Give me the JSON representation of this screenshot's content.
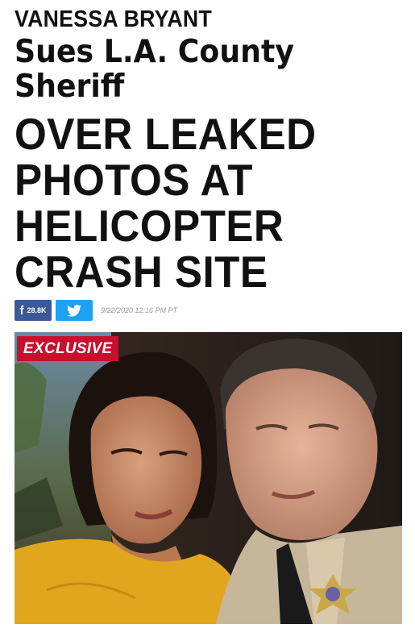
{
  "article": {
    "kicker": "VANESSA BRYANT",
    "subhead_lines": [
      "Sues L.A. County",
      "Sheriff"
    ],
    "headline_lines": [
      "OVER LEAKED",
      "PHOTOS AT",
      "HELICOPTER",
      "CRASH SITE"
    ]
  },
  "share": {
    "facebook_icon": "facebook-icon",
    "facebook_label": "f",
    "facebook_count": "28.8K",
    "twitter_icon": "twitter-bird-icon",
    "timestamp": "9/22/2020 12:16 PM PT"
  },
  "photo": {
    "badge": "EXCLUSIVE",
    "badge_color": "#c8102e"
  },
  "colors": {
    "facebook": "#3b5998",
    "twitter": "#1da1f2"
  }
}
